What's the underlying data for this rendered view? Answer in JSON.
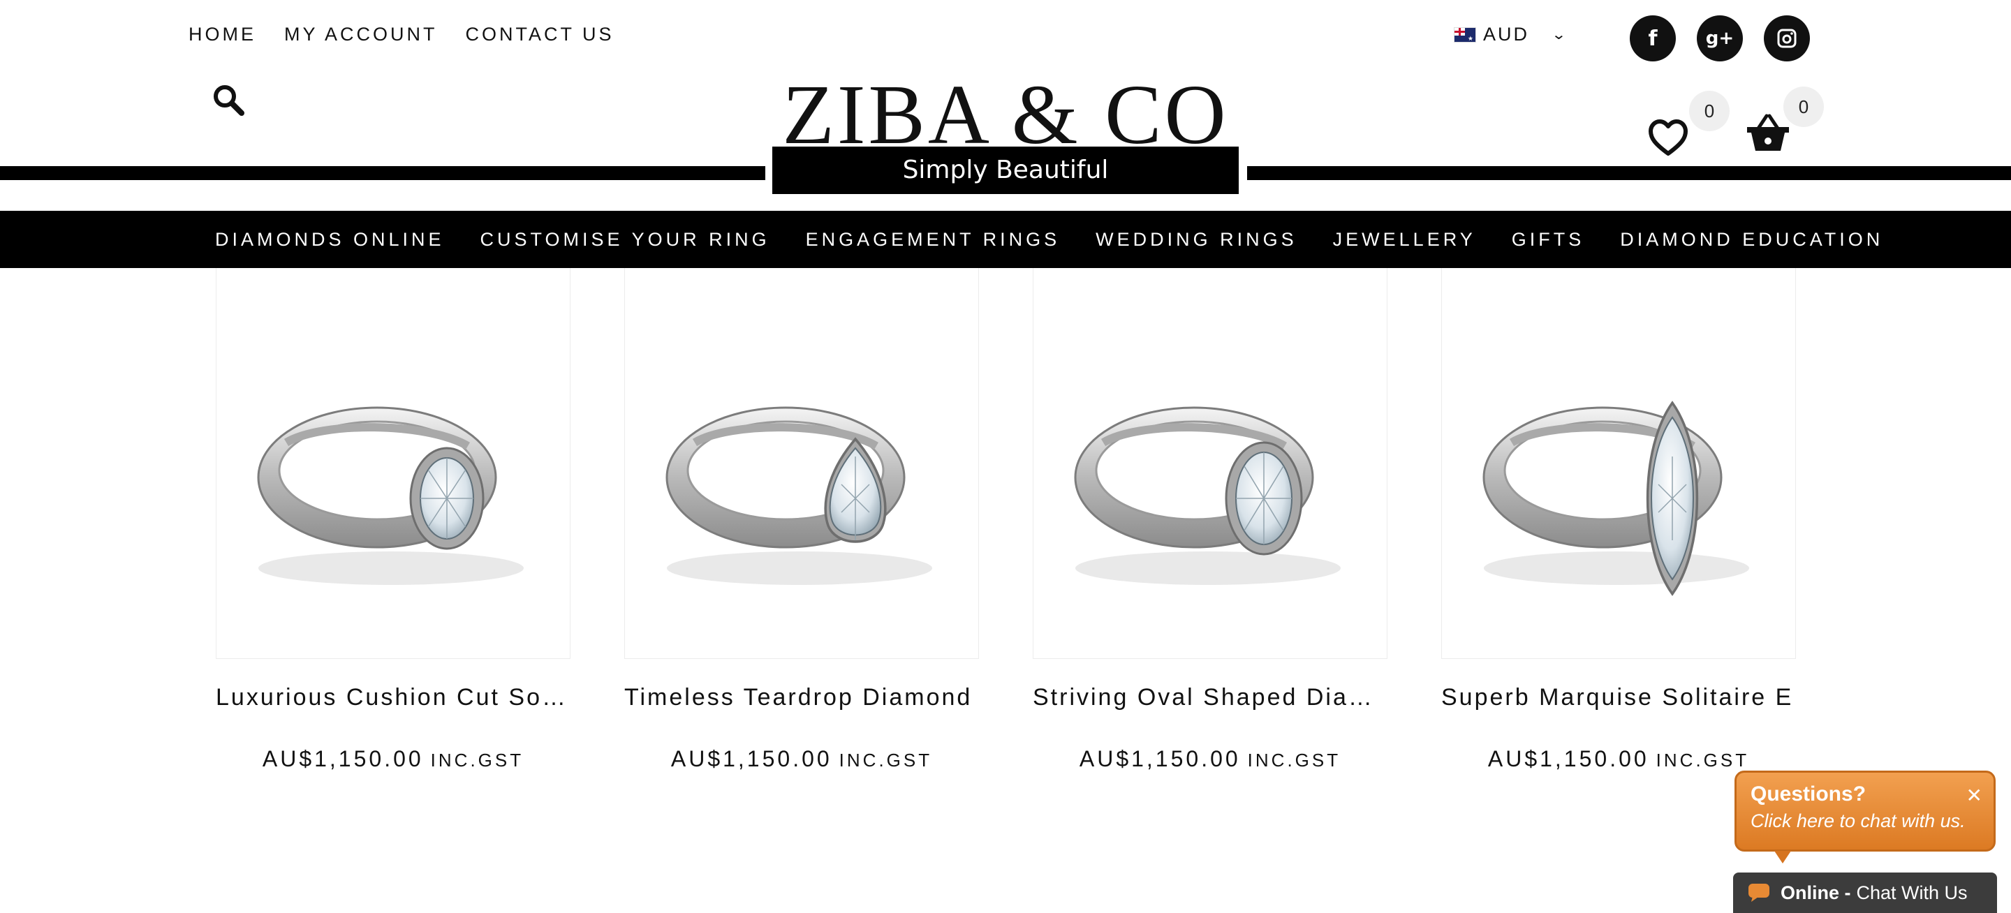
{
  "top_nav": [
    "HOME",
    "MY ACCOUNT",
    "CONTACT US"
  ],
  "currency": {
    "code": "AUD",
    "flag": "australia-flag"
  },
  "social": [
    {
      "name": "facebook",
      "glyph": "f"
    },
    {
      "name": "google-plus",
      "glyph": "g+"
    },
    {
      "name": "instagram",
      "glyph": "instagram"
    }
  ],
  "logo": {
    "text": "ZIBA & CO",
    "tagline": "Simply Beautiful"
  },
  "wishlist": {
    "count": "0"
  },
  "cart": {
    "count": "0"
  },
  "main_nav": [
    "DIAMONDS ONLINE",
    "CUSTOMISE YOUR RING",
    "ENGAGEMENT RINGS",
    "WEDDING RINGS",
    "JEWELLERY",
    "GIFTS",
    "DIAMOND EDUCATION"
  ],
  "products": [
    {
      "name": "Luxurious Cushion Cut Solitaire",
      "price": "AU$1,150.00",
      "suffix": "INC.GST",
      "shape": "cushion"
    },
    {
      "name": "Timeless Teardrop Diamond",
      "price": "AU$1,150.00",
      "suffix": "INC.GST",
      "shape": "pear"
    },
    {
      "name": "Striving Oval Shaped Diamond",
      "price": "AU$1,150.00",
      "suffix": "INC.GST",
      "shape": "oval"
    },
    {
      "name": "Superb Marquise Solitaire E",
      "price": "AU$1,150.00",
      "suffix": "INC.GST",
      "shape": "marquise"
    }
  ],
  "chat": {
    "title": "Questions?",
    "subtitle": "Click here to chat with us.",
    "close": "✕",
    "status": "Online -",
    "bar_text": "Chat With Us"
  },
  "colors": {
    "nav_bg": "#000000",
    "chat_orange": "#e88a34",
    "chat_bar": "#3c3c3c"
  }
}
